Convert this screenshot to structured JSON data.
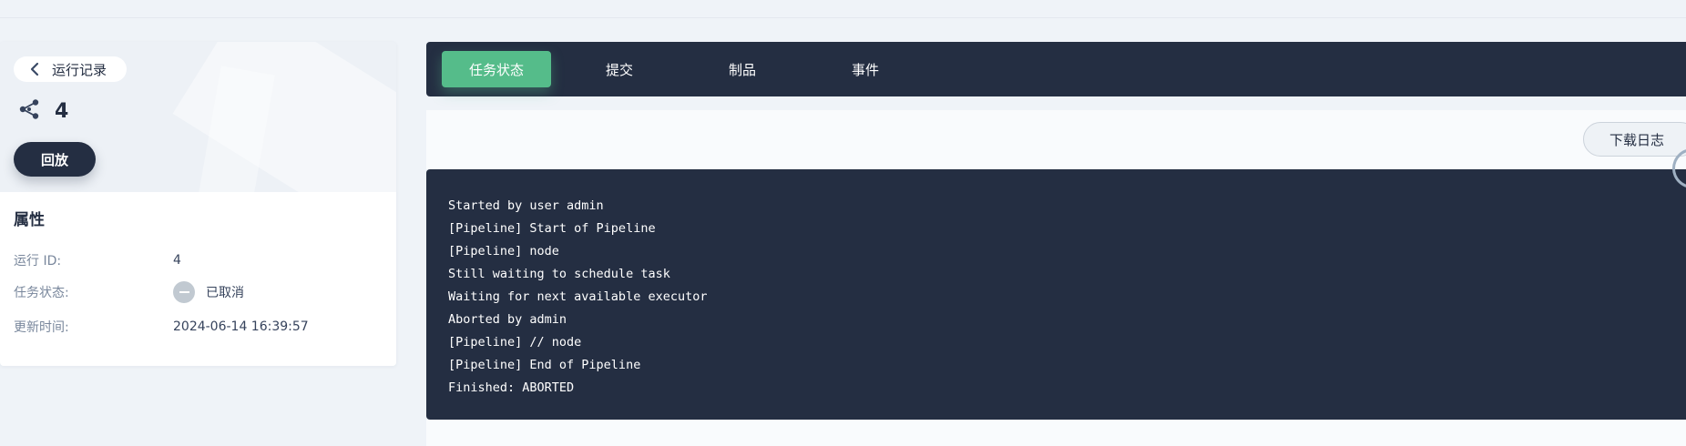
{
  "run_header": {
    "back_label": "运行记录",
    "run_number": "4",
    "replay_label": "回放"
  },
  "properties": {
    "title": "属性",
    "rows": [
      {
        "label": "运行 ID:",
        "value": "4"
      },
      {
        "label": "任务状态:",
        "value": "已取消",
        "status_icon": "minus-circle-icon",
        "status_color": "#c1c9d1"
      },
      {
        "label": "更新时间:",
        "value": "2024-06-14 16:39:57"
      }
    ]
  },
  "tabs": [
    {
      "label": "任务状态",
      "active": true
    },
    {
      "label": "提交",
      "active": false
    },
    {
      "label": "制品",
      "active": false
    },
    {
      "label": "事件",
      "active": false
    }
  ],
  "toolbar": {
    "download_label": "下载日志"
  },
  "log": {
    "lines": [
      "Started by user admin",
      "[Pipeline] Start of Pipeline",
      "[Pipeline] node",
      "Still waiting to schedule task",
      "Waiting for next available executor",
      "Aborted by admin",
      "[Pipeline] // node",
      "[Pipeline] End of Pipeline",
      "Finished: ABORTED"
    ]
  },
  "colors": {
    "dark": "#242e42",
    "accent_green": "#55bc8a",
    "page_bg": "#eff3f8",
    "muted_text": "#79879c"
  }
}
